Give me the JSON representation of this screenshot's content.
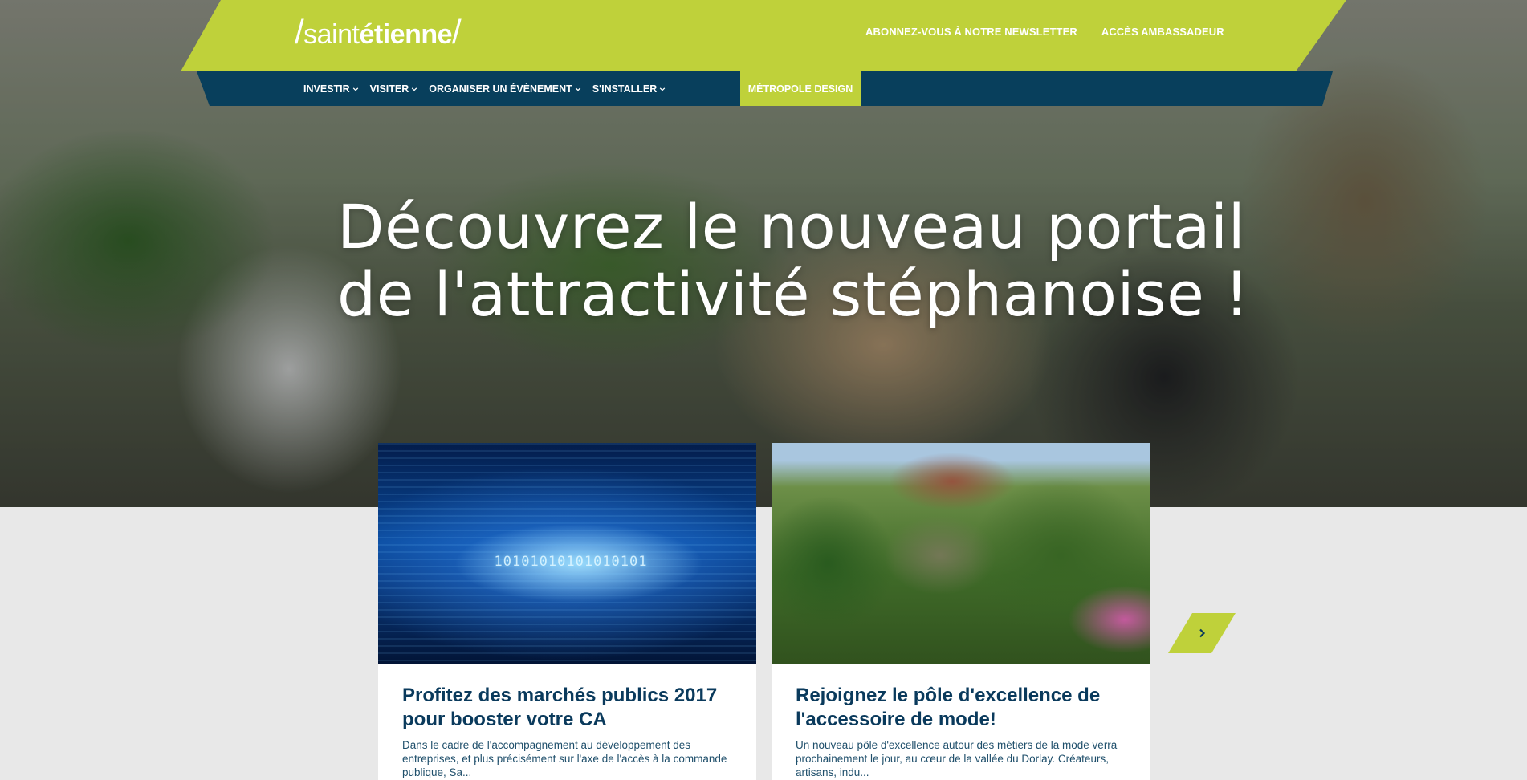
{
  "brand": {
    "logo_slash_left": "/",
    "logo_light": "saint",
    "logo_bold": "étienne",
    "logo_slash_right": "/",
    "colors": {
      "green": "#bfd13a",
      "navy": "#083f5c",
      "card_title": "#0a3a5c"
    }
  },
  "top_links": [
    {
      "label": "ABONNEZ-VOUS À NOTRE NEWSLETTER"
    },
    {
      "label": "ACCÈS AMBASSADEUR"
    }
  ],
  "nav": {
    "items": [
      {
        "label": "INVESTIR",
        "icon": "chevron-down-icon"
      },
      {
        "label": "VISITER",
        "icon": "chevron-down-icon"
      },
      {
        "label": "ORGANISER UN ÉVÈNEMENT",
        "icon": "chevron-down-icon"
      },
      {
        "label": "S'INSTALLER",
        "icon": "chevron-down-icon"
      }
    ],
    "featured": "MÉTROPOLE DESIGN"
  },
  "hero": {
    "title_line1": "Découvrez le nouveau portail",
    "title_line2": "de l'attractivité stéphanoise !"
  },
  "cards": [
    {
      "image_icon": "binary-data-image",
      "image_bits": "10101010101010101",
      "title": "Profitez des marchés publics 2017 pour booster votre CA",
      "excerpt": "Dans le cadre de l'accompagnement au développement des entreprises, et plus précisément sur l'axe de l'accès à la commande publique, Sa..."
    },
    {
      "image_icon": "mill-landscape-image",
      "title": "Rejoignez le pôle d'excellence de l'accessoire de mode!",
      "excerpt": "Un nouveau pôle d'excellence autour des métiers de la mode verra prochainement le jour, au cœur de la vallée du Dorlay. Créateurs, artisans, indu..."
    }
  ],
  "carousel": {
    "next_icon": "chevron-right-icon"
  }
}
